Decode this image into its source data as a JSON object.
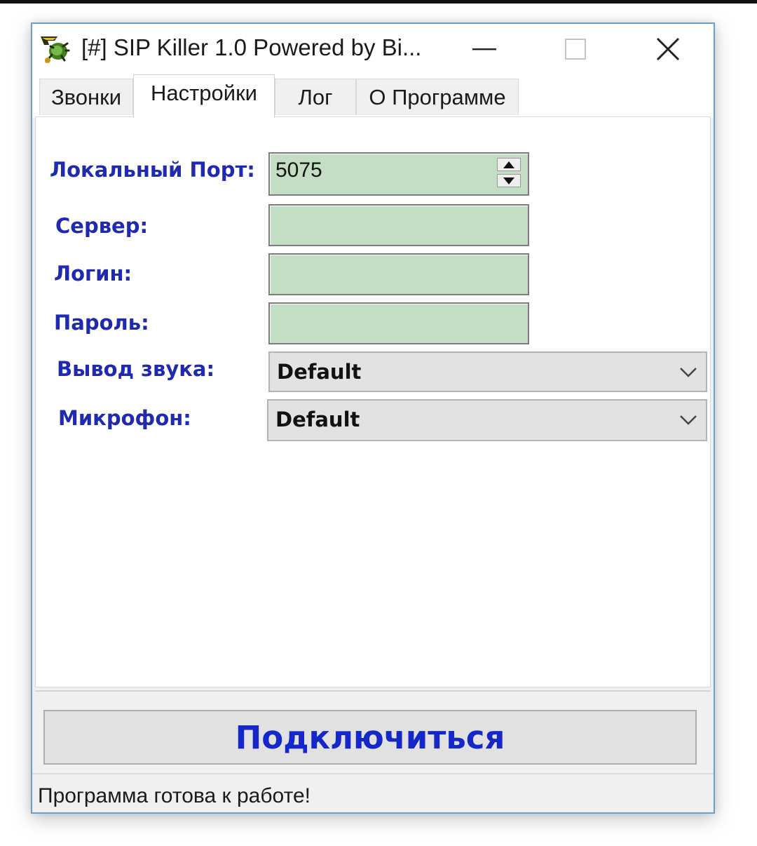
{
  "window": {
    "title": "[#] SIP Killer 1.0 Powered by Bi...",
    "icon": "bug-app-icon"
  },
  "title_buttons": {
    "minimize": "minimize-icon",
    "maximize": "maximize-icon",
    "close": "close-icon"
  },
  "tabs": [
    {
      "label": "Звонки",
      "active": false
    },
    {
      "label": "Настройки",
      "active": true
    },
    {
      "label": "Лог",
      "active": false
    },
    {
      "label": "О Программе",
      "active": false
    }
  ],
  "settings": {
    "local_port": {
      "label": "Локальный Порт:",
      "value": "5075"
    },
    "server": {
      "label": "Сервер:",
      "value": ""
    },
    "login": {
      "label": "Логин:",
      "value": ""
    },
    "password": {
      "label": "Пароль:",
      "value": ""
    },
    "audio_output": {
      "label": "Вывод звука:",
      "value": "Default"
    },
    "microphone": {
      "label": "Микрофон:",
      "value": "Default"
    }
  },
  "connect_button": {
    "label": "Подключиться"
  },
  "status": {
    "text": "Программа готова к работе!"
  },
  "colors": {
    "label_blue": "#1f2aae",
    "button_text_blue": "#1527c9",
    "field_green": "#c3dec3",
    "window_border": "#6d9ec8"
  }
}
